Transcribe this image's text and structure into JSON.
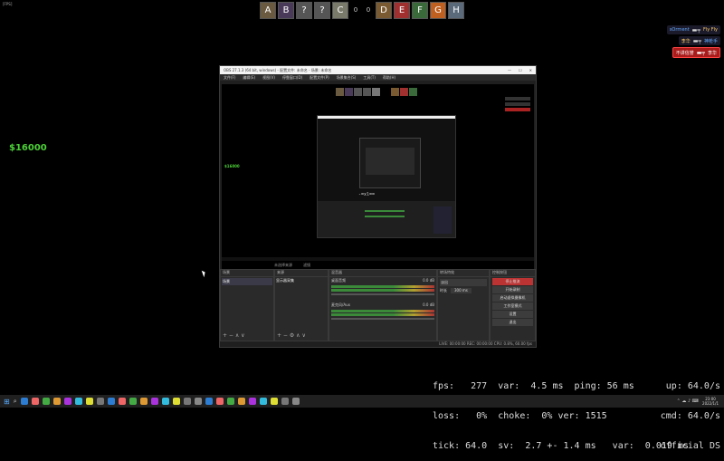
{
  "corner_tag": "[FPS]",
  "scoreboard": {
    "left_team": [
      "A",
      "B",
      "?",
      "?",
      "C"
    ],
    "left_score": "0",
    "right_score": "0",
    "right_team": [
      "D",
      "E",
      "F",
      "G",
      "H"
    ]
  },
  "killfeed": [
    {
      "attacker": "sOrrnent",
      "victim": "Fly Fly",
      "bg": "#1a1a2a",
      "icon": "gun-icon"
    },
    {
      "attacker": "李华",
      "victim": "神枪手",
      "bg": "#1a1a2a",
      "icon": "gun-icon"
    },
    {
      "attacker": "不讲信誉",
      "victim": "李华",
      "bg": "#aa1b1b",
      "icon": "gun-icon"
    }
  ],
  "money": "$16000",
  "netgraph": {
    "line1": "fps:   277  var:  4.5 ms  ping: 56 ms",
    "line2": "loss:   0%  choke:  0% ver: 1515",
    "line3": "tick: 64.0  sv:  2.7 +- 1.4 ms   var:  0.019 ms",
    "right1": "up: 64.0/s",
    "right2": "cmd: 64.0/s",
    "right3": "official DS"
  },
  "obs": {
    "title": "OBS 27.1.3 (64 bit, windows) - 配置文件: 未命名 - 场景: 未命名",
    "menu": [
      "文件(F)",
      "编辑(E)",
      "视图(V)",
      "停靠窗口(D)",
      "配置文件(P)",
      "场景集合(S)",
      "工具(T)",
      "帮助(H)"
    ],
    "preview_money": "$16000",
    "docks": {
      "scenes": "场景",
      "sources": "来源",
      "mixer": "混音器",
      "transitions": "转场特效",
      "controls": "控制按钮"
    },
    "scene_item": "场景",
    "source_item": "显示器采集",
    "mixer_tracks": [
      {
        "name": "桌面音频",
        "db": "0.0 dB"
      },
      {
        "name": "麦克风/Aux",
        "db": "0.0 dB"
      }
    ],
    "transition": "淡出",
    "duration_label": "时长",
    "duration": "300 ms",
    "controls": [
      "停止推流",
      "开始录制",
      "启动虚拟摄像机",
      "工作室模式",
      "设置",
      "退出"
    ],
    "status": "LIVE: 00:00:00   REC: 00:00:00   CPU: 0.8%, 60.00 fps",
    "no_source_hint": "未选择来源",
    "filters_label": "滤镜"
  },
  "taskbar": {
    "time": "23:00",
    "date": "2022/1/1",
    "icons": [
      "#2d7dd2",
      "#e66",
      "#4a4",
      "#d93",
      "#a3d",
      "#3bd",
      "#dd3",
      "#777",
      "#2d7dd2",
      "#e66",
      "#4a4",
      "#d93",
      "#a3d",
      "#3bd",
      "#dd3",
      "#777",
      "#888",
      "#2d7dd2",
      "#e66",
      "#4a4",
      "#d93",
      "#a3d",
      "#3bd",
      "#dd3",
      "#777",
      "#888"
    ]
  }
}
